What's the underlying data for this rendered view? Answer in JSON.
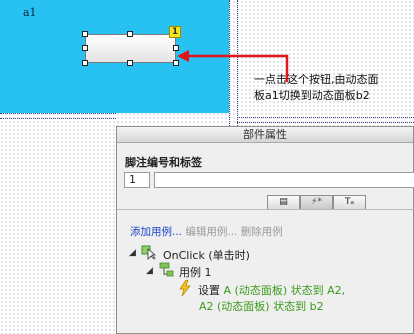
{
  "canvas": {
    "panel_name": "a1",
    "footnote_badge": "1",
    "callout_line1": "一点击这个按钮,由动态面",
    "callout_line2": "板a1切换到动态面板b2"
  },
  "properties_panel": {
    "title": "部件属性",
    "section_title": "脚注编号和标签",
    "footnote_number": "1",
    "footnote_label": "",
    "tabs": [
      {
        "icon": "notes-icon",
        "label": "▤"
      },
      {
        "icon": "interaction-icon",
        "label": "⚡*"
      },
      {
        "icon": "format-icon",
        "label": "Tₐ"
      }
    ],
    "add_case": "添加用例...",
    "edit_case": "编辑用例...",
    "delete_case": "删除用例",
    "event": "OnClick (单击时)",
    "case": "用例 1",
    "action_line1_prefix": "设置",
    "action_line1": "A (动态面板) 状态到 A2,",
    "action_line2": "A2 (动态面板) 状态到 b2"
  },
  "colors": {
    "panel_fill": "#27c2f2",
    "arrow": "#e2151c",
    "link": "#1a44c8",
    "action_text": "#3c9a1a"
  }
}
